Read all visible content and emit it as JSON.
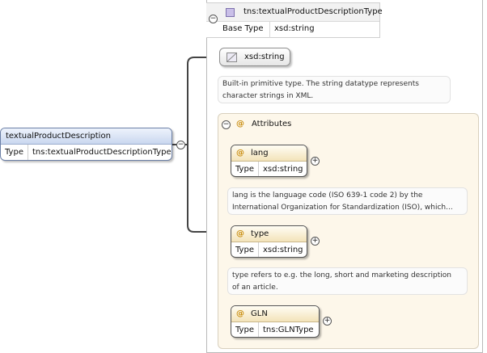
{
  "complex_type": {
    "name": "tns:textualProductDescriptionType",
    "base_type_label": "Base Type",
    "base_type_value": "xsd:string"
  },
  "root_element": {
    "name": "textualProductDescription",
    "type_label": "Type",
    "type_value": "tns:textualProductDescriptionType"
  },
  "simple_type": {
    "name": "xsd:string",
    "doc_lines": [
      "Built-in primitive type. The string datatype represents",
      "character strings in XML."
    ]
  },
  "attributes_group": {
    "label": "Attributes",
    "items": [
      {
        "name": "lang",
        "type_label": "Type",
        "type_value": "xsd:string",
        "doc_lines": [
          "lang is the language code (ISO 639-1 code 2) by the",
          "International Organization for Standardization (ISO), which..."
        ]
      },
      {
        "name": "type",
        "type_label": "Type",
        "type_value": "xsd:string",
        "doc_lines": [
          "type refers to e.g. the long, short and marketing description",
          "of an article."
        ]
      },
      {
        "name": "GLN",
        "type_label": "Type",
        "type_value": "tns:GLNType",
        "doc_lines": []
      }
    ]
  },
  "icons": {
    "at": "@",
    "minus": "−",
    "plus": "+"
  },
  "colors": {
    "root_header": "#c9d7ef",
    "attr_header": "#f3e3b9",
    "attributes_background": "#fdf7ea",
    "type_icon": "#c9bfe8",
    "at_symbol": "#c98d10"
  }
}
